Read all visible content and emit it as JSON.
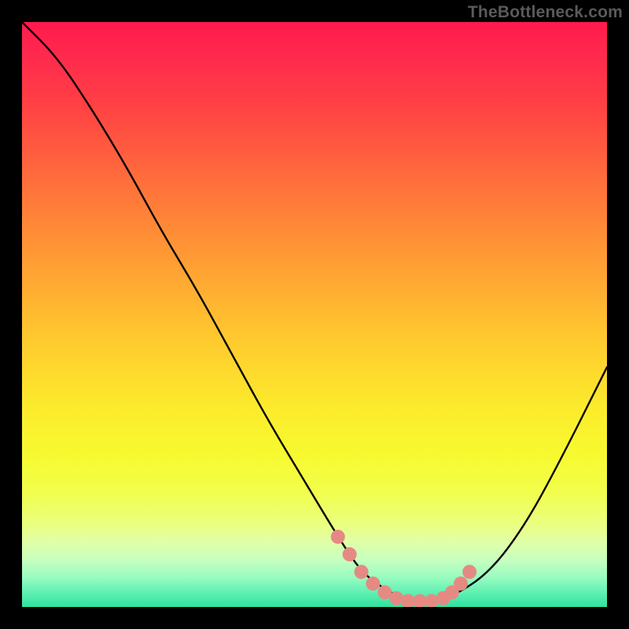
{
  "watermark": "TheBottleneck.com",
  "chart_data": {
    "type": "line",
    "title": "",
    "xlabel": "",
    "ylabel": "",
    "xlim": [
      0,
      100
    ],
    "ylim": [
      0,
      100
    ],
    "series": [
      {
        "name": "bottleneck-curve",
        "x": [
          0,
          6,
          12,
          18,
          24,
          30,
          36,
          42,
          48,
          54,
          58,
          62,
          66,
          70,
          74,
          80,
          86,
          92,
          100
        ],
        "y": [
          100,
          94,
          85,
          75,
          64,
          54,
          43,
          32,
          22,
          12,
          6,
          3,
          1,
          1,
          2,
          6,
          14,
          25,
          41
        ]
      }
    ],
    "highlight": {
      "name": "optimal-range",
      "color": "#e58a82",
      "points": [
        {
          "x": 54,
          "y": 12
        },
        {
          "x": 56,
          "y": 9
        },
        {
          "x": 58,
          "y": 6
        },
        {
          "x": 60,
          "y": 4
        },
        {
          "x": 62,
          "y": 2.5
        },
        {
          "x": 64,
          "y": 1.5
        },
        {
          "x": 66,
          "y": 1
        },
        {
          "x": 68,
          "y": 1
        },
        {
          "x": 70,
          "y": 1
        },
        {
          "x": 72,
          "y": 1.5
        },
        {
          "x": 73.5,
          "y": 2.5
        },
        {
          "x": 75,
          "y": 4
        },
        {
          "x": 76.5,
          "y": 6
        }
      ]
    },
    "background": "spectral-heat-gradient"
  }
}
